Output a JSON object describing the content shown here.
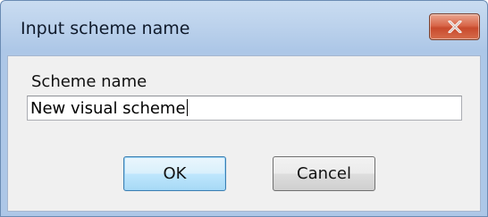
{
  "window": {
    "title": "Input scheme name"
  },
  "form": {
    "scheme_label": "Scheme name",
    "scheme_value": "New visual scheme"
  },
  "buttons": {
    "ok_label": "OK",
    "cancel_label": "Cancel"
  },
  "icons": {
    "close": "close-icon"
  },
  "colors": {
    "titlebar": "#bcd2ec",
    "close_button": "#c84a2d",
    "client_background": "#f0f0f0",
    "default_button_border": "#3c7fb1"
  }
}
